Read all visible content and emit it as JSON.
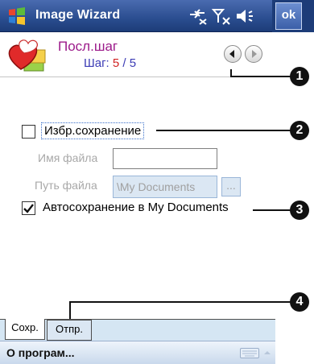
{
  "titlebar": {
    "app_title": "Image Wizard",
    "ok_label": "ok",
    "icons": [
      "windows-start-icon",
      "connectivity-icon",
      "signal-off-icon",
      "speaker-icon"
    ]
  },
  "header": {
    "step_title": "Посл.шаг",
    "step_prefix": "Шаг: ",
    "step_current": "5",
    "step_separator": " / ",
    "step_total": "5"
  },
  "form": {
    "save_as_label": "Избр.сохранение",
    "save_as_checked": false,
    "file_name_label": "Имя файла",
    "file_name_value": "",
    "file_path_label": "Путь файла",
    "file_path_value": "\\My Documents",
    "browse_label": "...",
    "autosave_label": "Автосохранение в My Documents",
    "autosave_checked": true
  },
  "callouts": [
    "1",
    "2",
    "3",
    "4"
  ],
  "tabs": [
    {
      "label": "Сохр.",
      "active": true
    },
    {
      "label": "Отпр.",
      "active": false
    }
  ],
  "menubar": {
    "left_item": "О програм..."
  },
  "colors": {
    "title_bg": "#2a4d8f",
    "step_title": "#9c1a8a",
    "step_current": "#d12222",
    "step_text": "#3b3bb5",
    "tab_strip": "#d5e6f3"
  }
}
